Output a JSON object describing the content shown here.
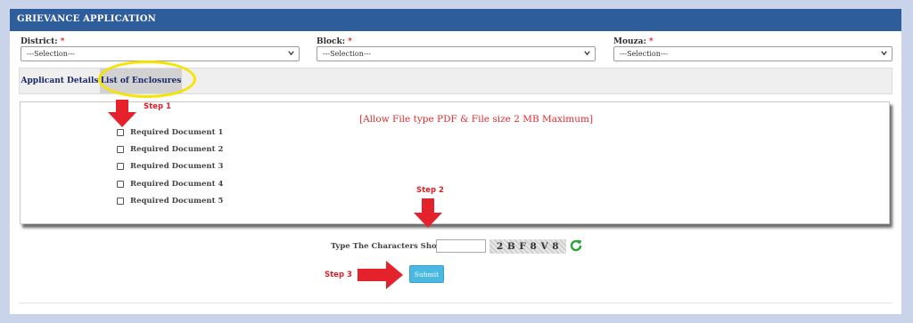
{
  "header": {
    "title": "GRIEVANCE APPLICATION"
  },
  "filters": {
    "district": {
      "label": "District:",
      "required_mark": "*",
      "value": "---Selection---"
    },
    "block": {
      "label": "Block:",
      "required_mark": "*",
      "value": "---Selection---"
    },
    "mouza": {
      "label": "Mouza:",
      "required_mark": "*",
      "value": "---Selection---"
    }
  },
  "tabs": [
    {
      "label": "Applicant Details"
    },
    {
      "label": "List of Enclosures",
      "active": true
    }
  ],
  "enclosures": {
    "notice": "[Allow File type PDF & File size 2 MB Maximum]",
    "documents": [
      {
        "label": "Required Document 1"
      },
      {
        "label": "Required Document 2"
      },
      {
        "label": "Required Document 3"
      },
      {
        "label": "Required Document 4"
      },
      {
        "label": "Required Document 5"
      }
    ]
  },
  "steps": {
    "step1": "Step 1",
    "step2": "Step 2",
    "step3": "Step 3"
  },
  "captcha": {
    "label": "Type The Characters Shown",
    "required_mark": "*",
    "text": "2 B  F 8 V 8",
    "input_value": ""
  },
  "submit": {
    "label": "Submit"
  },
  "colors": {
    "header_bg": "#2d5d9b",
    "accent_red": "#e0202a",
    "highlight_yellow": "#f5e400",
    "submit_bg": "#49b8e2",
    "page_bg": "#c9d3ea"
  },
  "icons": {
    "select_caret": "chevron-down-icon",
    "refresh": "refresh-icon",
    "annotation_arrow": "arrow-icon"
  }
}
